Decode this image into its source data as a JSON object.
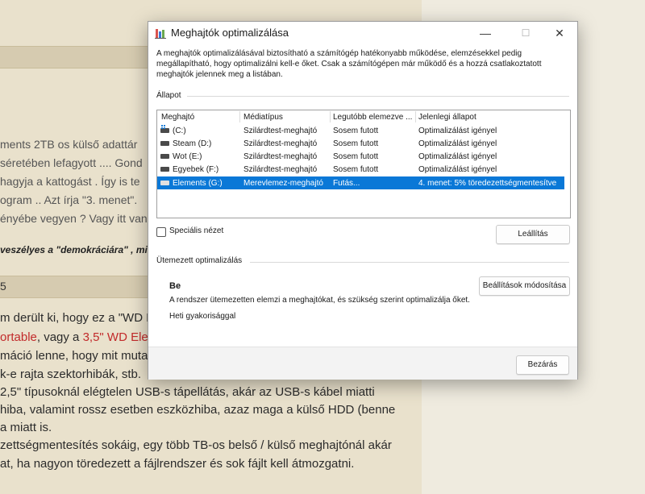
{
  "background": {
    "lines": [
      "ments 2TB os külső adattár",
      "séretében lefagyott .... Gond",
      "hagyja a kattogást . Így is te",
      "ogram .. Azt írja \"3. menet\".",
      "ényébe vegyen ? Vagy itt van",
      "veszélyes a \"demokráciára\" , min",
      "5",
      "m derült ki, hogy ez a \"WD E",
      "ortable",
      ", vagy a ",
      "3,5\" WD Elen",
      "máció lenne, hogy mit muta",
      "k-e rajta szektorhibák, stb.",
      "2,5\" típusoknál elégtelen USB-s tápellátás, akár az USB-s kábel miatti",
      "hiba, valamint rossz esetben eszközhiba, azaz maga a külső HDD (benne",
      "a miatt is.",
      "zettségmentesítés sokáig, egy több TB-os belső / külső meghajtónál akár",
      "at, ha nagyon töredezett a fájlrendszer és sok fájlt kell átmozgatni."
    ]
  },
  "dialog": {
    "title": "Meghajtók optimalizálása",
    "icons": {
      "app": "defrag-app-icon",
      "minimize": "—",
      "maximize": "☐",
      "close": "✕"
    },
    "description": "A meghajtók optimalizálásával biztosítható a számítógép hatékonyabb működése, elemzésekkel pedig megállapítható, hogy optimalizálni kell-e őket. Csak a számítógépen már működő és a hozzá csatlakoztatott meghajtók jelennek meg a listában.",
    "status_label": "Állapot",
    "columns": [
      "Meghajtó",
      "Médiatípus",
      "Legutóbb elemezve ...",
      "Jelenlegi állapot"
    ],
    "drives": [
      {
        "name": "(C:)",
        "media": "Szilárdtest-meghajtó",
        "last": "Sosem futott",
        "state": "Optimalizálást igényel"
      },
      {
        "name": "Steam (D:)",
        "media": "Szilárdtest-meghajtó",
        "last": "Sosem futott",
        "state": "Optimalizálást igényel"
      },
      {
        "name": "Wot (E:)",
        "media": "Szilárdtest-meghajtó",
        "last": "Sosem futott",
        "state": "Optimalizálást igényel"
      },
      {
        "name": "Egyebek (F:)",
        "media": "Szilárdtest-meghajtó",
        "last": "Sosem futott",
        "state": "Optimalizálást igényel"
      },
      {
        "name": "Elements (G:)",
        "media": "Merevlemez-meghajtó",
        "last": "Futás...",
        "state": "4. menet: 5% töredezettségmentesítve"
      }
    ],
    "advanced_view_label": "Speciális nézet",
    "stop_button": "Leállítás",
    "scheduled_label": "Ütemezett optimalizálás",
    "schedule_status": "Be",
    "schedule_desc": "A rendszer ütemezetten elemzi a meghajtókat, és szükség szerint optimalizálja őket.",
    "schedule_freq": "Heti gyakorisággal",
    "change_settings_button": "Beállítások módosítása",
    "close_button": "Bezárás",
    "selection_color": "#0a78d7"
  }
}
